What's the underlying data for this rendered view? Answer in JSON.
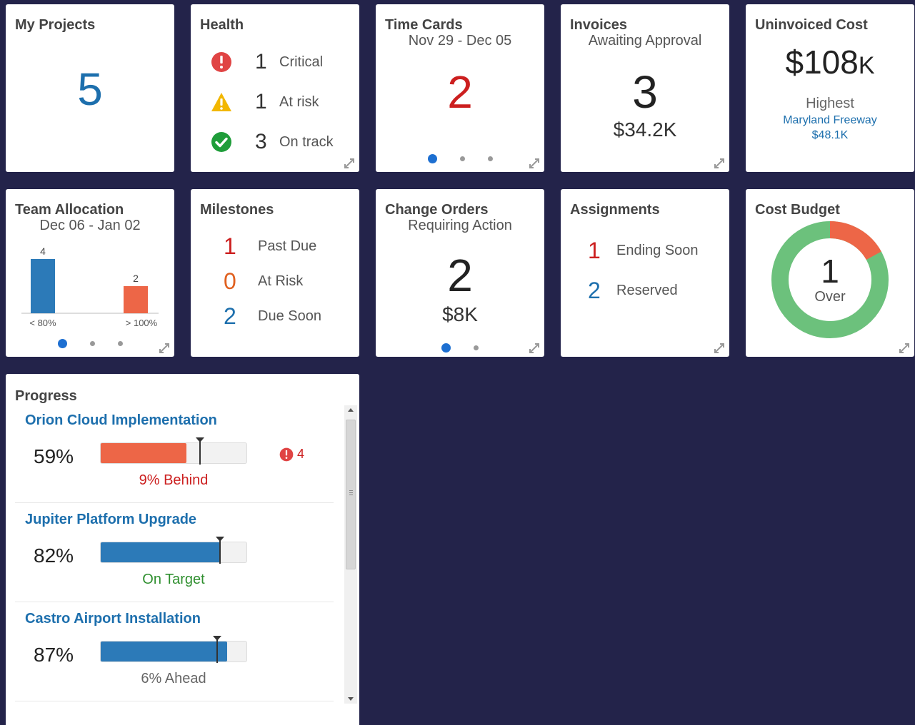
{
  "my_projects": {
    "title": "My Projects",
    "count": "5"
  },
  "health": {
    "title": "Health",
    "items": [
      {
        "count": "1",
        "label": "Critical",
        "icon": "error-icon"
      },
      {
        "count": "1",
        "label": "At risk",
        "icon": "warning-icon"
      },
      {
        "count": "3",
        "label": "On track",
        "icon": "check-icon"
      }
    ]
  },
  "time_cards": {
    "title": "Time Cards",
    "subtitle": "Nov 29 - Dec 05",
    "count": "2"
  },
  "invoices": {
    "title": "Invoices",
    "subtitle": "Awaiting Approval",
    "count": "3",
    "amount": "$34.2K"
  },
  "uninvoiced_cost": {
    "title": "Uninvoiced Cost",
    "amount": "$108",
    "amount_unit": "K",
    "highest_label": "Highest",
    "highest_project": "Maryland Freeway",
    "highest_amount": "$48.1K"
  },
  "team_allocation": {
    "title": "Team Allocation",
    "subtitle": "Dec 06 - Jan 02"
  },
  "milestones": {
    "title": "Milestones",
    "items": [
      {
        "count": "1",
        "label": "Past Due"
      },
      {
        "count": "0",
        "label": "At Risk"
      },
      {
        "count": "2",
        "label": "Due Soon"
      }
    ]
  },
  "change_orders": {
    "title": "Change Orders",
    "subtitle": "Requiring Action",
    "count": "2",
    "amount": "$8K"
  },
  "assignments": {
    "title": "Assignments",
    "items": [
      {
        "count": "1",
        "label": "Ending Soon"
      },
      {
        "count": "2",
        "label": "Reserved"
      }
    ]
  },
  "cost_budget": {
    "title": "Cost Budget",
    "count": "1",
    "label": "Over",
    "over_fraction": 0.17
  },
  "progress": {
    "title": "Progress",
    "projects": [
      {
        "name": "Orion Cloud Implementation",
        "percent": "59%",
        "fill": 0.59,
        "target": 0.68,
        "status": "9% Behind",
        "status_color": "#cc1f1f",
        "bar_color": "#ed6647",
        "issues": "4"
      },
      {
        "name": "Jupiter Platform Upgrade",
        "percent": "82%",
        "fill": 0.82,
        "target": 0.82,
        "status": "On Target",
        "status_color": "#2f8f2f",
        "bar_color": "#2c7ab8",
        "issues": ""
      },
      {
        "name": "Castro Airport Installation",
        "percent": "87%",
        "fill": 0.87,
        "target": 0.8,
        "status": "6%  Ahead",
        "status_color": "#666",
        "bar_color": "#2c7ab8",
        "issues": ""
      }
    ]
  },
  "chart_data": {
    "type": "bar",
    "categories": [
      "< 80%",
      "> 100%"
    ],
    "values": [
      4,
      2
    ],
    "colors": [
      "#2c7ab8",
      "#ed6647"
    ]
  },
  "colors": {
    "background": "#23234a",
    "accent_blue": "#1d6fad",
    "red": "#cc1f1f",
    "green": "#2f8f2f",
    "orange": "#ed6647"
  }
}
